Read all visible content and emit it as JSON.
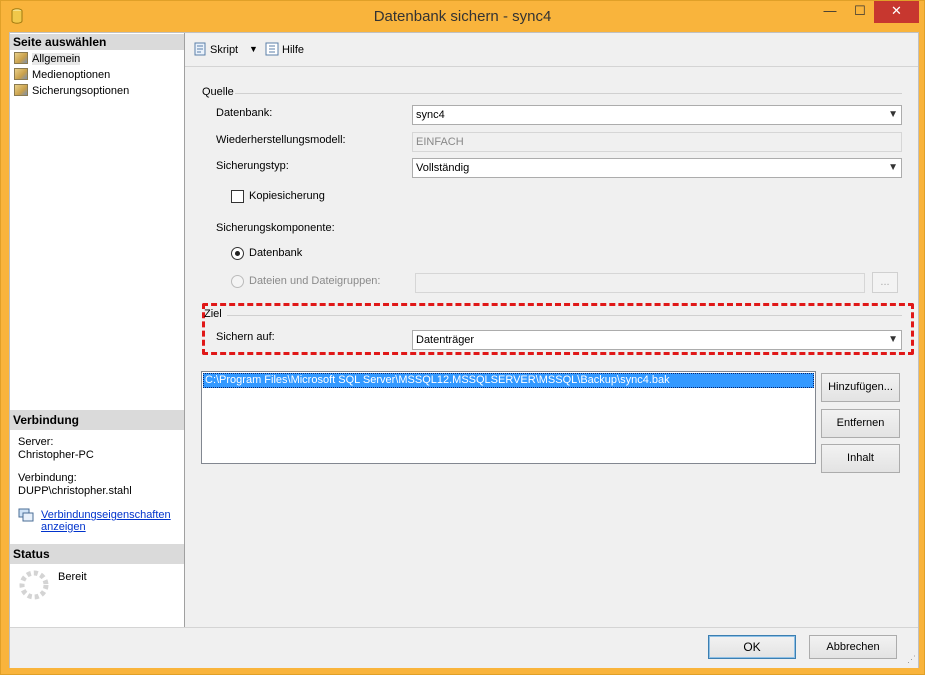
{
  "window": {
    "title": "Datenbank sichern - sync4",
    "controls": {
      "minimize": "—",
      "maximize": "☐",
      "close": "✕"
    }
  },
  "left_pane": {
    "select_page_heading": "Seite auswählen",
    "pages": [
      "Allgemein",
      "Medienoptionen",
      "Sicherungsoptionen"
    ],
    "connection_heading": "Verbindung",
    "server_label": "Server:",
    "server_value": "Christopher-PC",
    "connection_label": "Verbindung:",
    "connection_value": "DUPP\\christopher.stahl",
    "connection_link_line1": "Verbindungseigenschaften",
    "connection_link_line2": "anzeigen",
    "status_heading": "Status",
    "status_value": "Bereit"
  },
  "toolbar": {
    "script_label": "Skript",
    "help_label": "Hilfe"
  },
  "source": {
    "group_label": "Quelle",
    "database_label": "Datenbank:",
    "database_value": "sync4",
    "recovery_model_label": "Wiederherstellungsmodell:",
    "recovery_model_value": "EINFACH",
    "backup_type_label": "Sicherungstyp:",
    "backup_type_value": "Vollständig",
    "copy_only_label": "Kopiesicherung",
    "copy_only_checked": false,
    "component_label": "Sicherungskomponente:",
    "component_database_label": "Datenbank",
    "component_files_label": "Dateien und Dateigruppen:",
    "browse_label": "..."
  },
  "destination": {
    "group_label": "Ziel",
    "backup_to_label": "Sichern auf:",
    "backup_to_value": "Datenträger",
    "paths": [
      "C:\\Program Files\\Microsoft SQL Server\\MSSQL12.MSSQLSERVER\\MSSQL\\Backup\\sync4.bak"
    ],
    "add_button": "Hinzufügen...",
    "remove_button": "Entfernen",
    "contents_button": "Inhalt"
  },
  "footer": {
    "ok_button": "OK",
    "cancel_button": "Abbrechen"
  },
  "colors": {
    "title_bar": "#f9b43c",
    "close_button": "#c7372f",
    "highlight_dashed": "#e01818",
    "selection": "#3399ff"
  }
}
